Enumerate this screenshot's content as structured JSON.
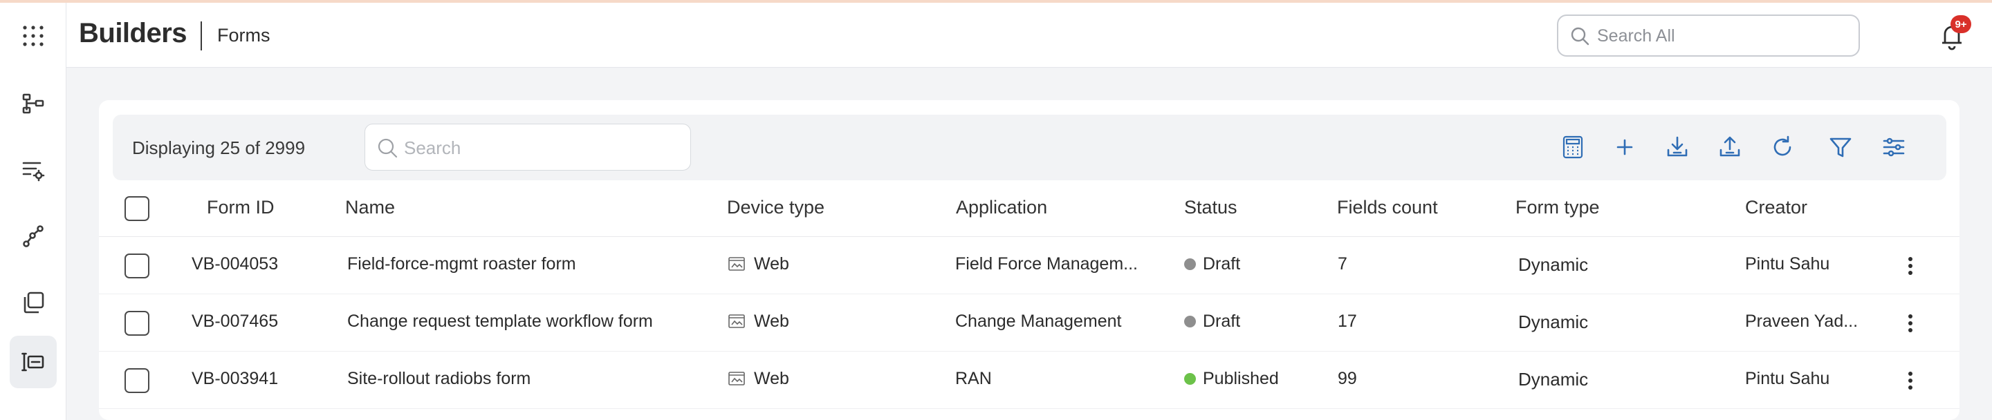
{
  "app": {
    "title": "Builders",
    "breadcrumb": "Forms"
  },
  "header": {
    "search_placeholder": "Search All",
    "notification_badge": "9+"
  },
  "rail": {
    "icons": [
      "apps-grid-icon",
      "hierarchy-icon",
      "list-settings-icon",
      "workflow-icon",
      "copy-icon",
      "form-builder-icon"
    ],
    "active": "form-builder-icon"
  },
  "toolbar": {
    "count_text": "Displaying 25 of 2999",
    "search_placeholder": "Search",
    "actions": [
      "calculator-icon",
      "add-icon",
      "download-icon",
      "upload-icon",
      "refresh-icon",
      "filter-icon",
      "column-settings-icon"
    ]
  },
  "table": {
    "columns": {
      "form_id": "Form ID",
      "name": "Name",
      "device_type": "Device type",
      "application": "Application",
      "status": "Status",
      "fields_count": "Fields count",
      "form_type": "Form type",
      "creator": "Creator"
    },
    "rows": [
      {
        "form_id": "VB-004053",
        "name": "Field-force-mgmt roaster form",
        "device_type": "Web",
        "application": "Field Force Managem...",
        "status": "Draft",
        "fields_count": "7",
        "form_type": "Dynamic",
        "creator": "Pintu Sahu"
      },
      {
        "form_id": "VB-007465",
        "name": "Change request template workflow form",
        "device_type": "Web",
        "application": "Change Management",
        "status": "Draft",
        "fields_count": "17",
        "form_type": "Dynamic",
        "creator": "Praveen Yad..."
      },
      {
        "form_id": "VB-003941",
        "name": "Site-rollout radiobs form",
        "device_type": "Web",
        "application": "RAN",
        "status": "Published",
        "fields_count": "99",
        "form_type": "Dynamic",
        "creator": "Pintu Sahu"
      }
    ]
  },
  "colors": {
    "accent": "#2f6db5",
    "draft": "#8e8e8e",
    "published": "#6cc24a",
    "badge": "#d9302a"
  }
}
